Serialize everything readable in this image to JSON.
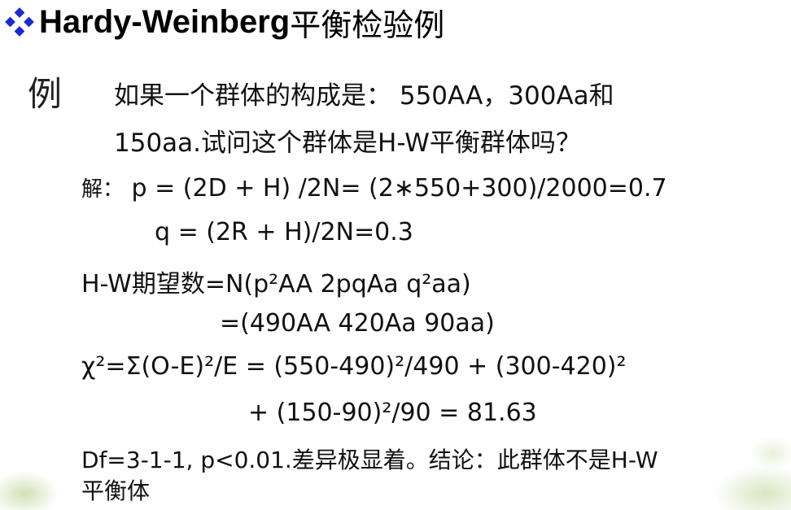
{
  "title": {
    "bullet_icon": "diamond-bullet-icon",
    "bullet_color": "#1a2bd6",
    "english": "Hardy-Weinberg",
    "chinese": "平衡检验例"
  },
  "example_mark": "例",
  "question": {
    "line1": "如果一个群体的构成是： 550AA，300Aa和",
    "line2": "150aa.试问这个群体是H-W平衡群体吗？"
  },
  "solution": {
    "line1_label": "解：",
    "line1_text": " p = (2D + H) /2N= (2∗550+300)/2000=0.7",
    "line2": "q = (2R + H)/2N=0.3",
    "line3": "H-W期望数=N(p²AA 2pqAa q²aa)",
    "line4": "=(490AA 420Aa 90aa)",
    "line5": "χ²=Σ(O-E)²/E =  (550-490)²/490 + (300-420)²",
    "line6": "+ (150-90)²/90 = 81.63",
    "line7": "Df=3-1-1, p<0.01.差异极显着。结论：此群体不是H-W",
    "line8": "平衡体"
  }
}
